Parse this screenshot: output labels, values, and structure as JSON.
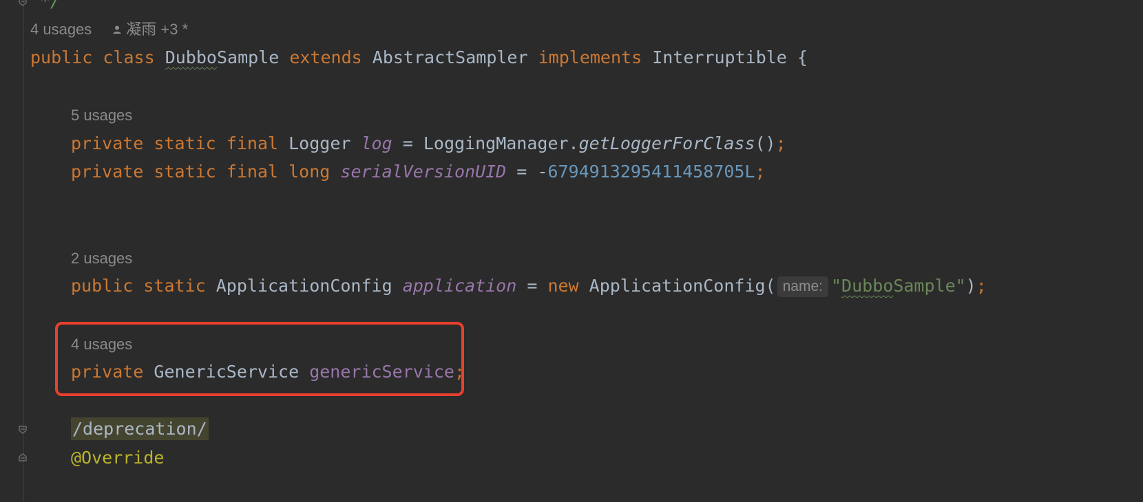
{
  "editor": {
    "top_comment": "*/",
    "class_usages": "4 usages",
    "class_author": "凝雨 +3 *",
    "class_decl": {
      "public": "public",
      "class": "class",
      "name_squiggled": "Dubbo",
      "name_rest": "Sample",
      "extends": "extends",
      "superclass": "AbstractSampler",
      "implements": "implements",
      "interface": "Interruptible",
      "brace": "{"
    },
    "log_usages": "5 usages",
    "log_line": {
      "private": "private",
      "static": "static",
      "final": "final",
      "type": "Logger",
      "name": "log",
      "eq": "=",
      "owner": "LoggingManager.",
      "method": "getLoggerForClass",
      "call": "()",
      "semi": ";"
    },
    "serial_line": {
      "private": "private",
      "static": "static",
      "final": "final",
      "type": "long",
      "name": "serialVersionUID",
      "eq": "= -",
      "value": "6794913295411458705L",
      "semi": ";"
    },
    "app_usages": "2 usages",
    "app_line": {
      "public": "public",
      "static": "static",
      "type": "ApplicationConfig",
      "name": "application",
      "eq": "=",
      "new": "new",
      "ctor": "ApplicationConfig(",
      "hint": "name:",
      "str_quote_open": "\"",
      "str_squiggled": "Dubbo",
      "str_rest": "Sample\"",
      "close": ")",
      "semi": ";"
    },
    "generic_usages": "4 usages",
    "generic_line": {
      "private": "private",
      "type": "GenericService",
      "name": "genericService",
      "semi": ";"
    },
    "deprecation_comment": "/deprecation/",
    "override_annotation": "@Override"
  }
}
